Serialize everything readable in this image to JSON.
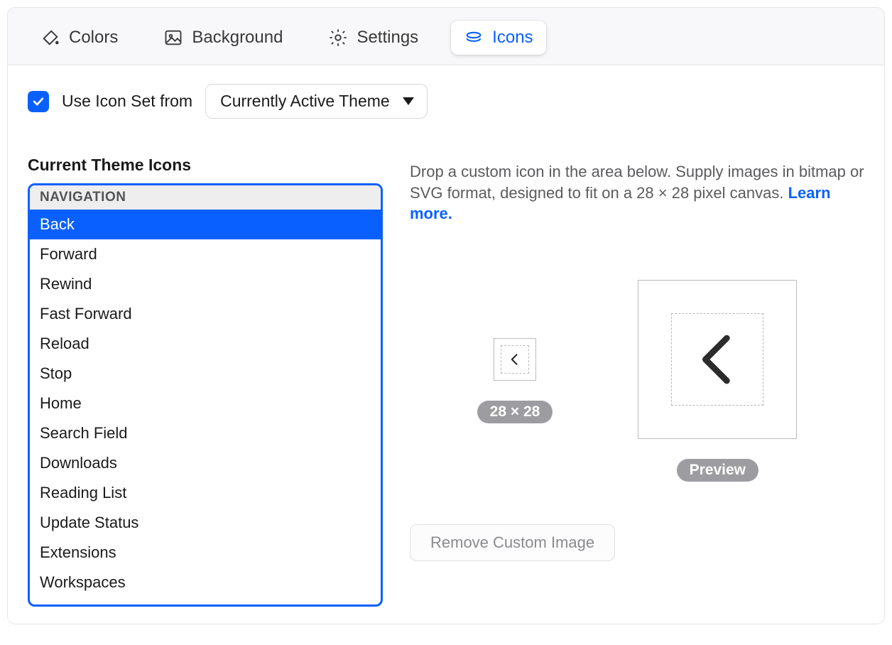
{
  "tabs": {
    "colors": "Colors",
    "background": "Background",
    "settings": "Settings",
    "icons": "Icons",
    "active": "icons"
  },
  "toolbar": {
    "use_icon_set_label": "Use Icon Set from",
    "select_value": "Currently Active Theme",
    "use_icon_set_checked": true
  },
  "list": {
    "title": "Current Theme Icons",
    "group_header": "NAVIGATION",
    "items": [
      "Back",
      "Forward",
      "Rewind",
      "Fast Forward",
      "Reload",
      "Stop",
      "Home",
      "Search Field",
      "Downloads",
      "Reading List",
      "Update Status",
      "Extensions",
      "Workspaces"
    ],
    "selected_index": 0
  },
  "help": {
    "text_before": "Drop a custom icon in the area below. Supply images in bitmap or SVG format, designed to fit on a 28 × 28 pixel canvas. ",
    "link": "Learn more."
  },
  "preview": {
    "size_badge": "28 × 28",
    "preview_badge": "Preview"
  },
  "actions": {
    "remove_label": "Remove Custom Image"
  }
}
